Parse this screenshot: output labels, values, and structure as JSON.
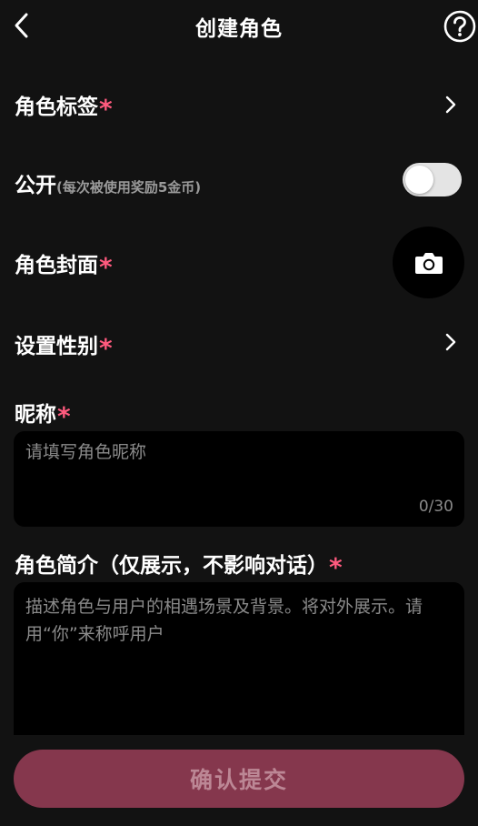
{
  "header": {
    "title": "创建角色"
  },
  "rows": {
    "tags": {
      "label": "角色标签",
      "required": "*"
    },
    "public": {
      "label": "公开",
      "hint": "(每次被使用奖励5金币)",
      "enabled": false
    },
    "cover": {
      "label": "角色封面",
      "required": "*"
    },
    "gender": {
      "label": "设置性别",
      "required": "*"
    }
  },
  "nickname": {
    "label": "昵称",
    "required": "*",
    "placeholder": "请填写角色昵称",
    "value": "",
    "counter": "0/30"
  },
  "intro": {
    "label": "角色简介（仅展示，不影响对话）",
    "required": "*",
    "placeholder": "描述角色与用户的相遇场景及背景。将对外展示。请用“你”来称呼用户",
    "value": ""
  },
  "submit": {
    "label": "确认提交"
  },
  "colors": {
    "background": "#121212",
    "field": "#000000",
    "accent": "#ff5a7e",
    "submit_bg": "#85374d",
    "submit_text": "#bc8795"
  },
  "icons": {
    "back": "chevron-left-icon",
    "help": "question-circle-icon",
    "arrow": "chevron-right-icon",
    "camera": "camera-icon"
  }
}
